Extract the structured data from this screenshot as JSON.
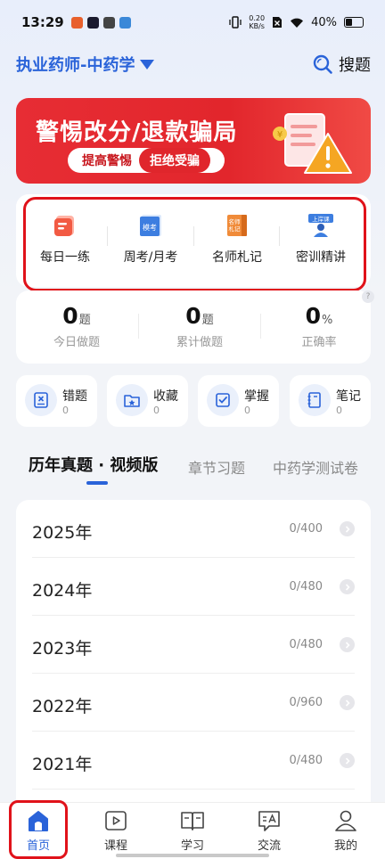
{
  "status_bar": {
    "time": "13:29",
    "net_speed_value": "0.20",
    "net_speed_unit": "KB/s",
    "battery": "40%"
  },
  "header": {
    "subject": "执业药师-中药学",
    "search_label": "搜题"
  },
  "banner": {
    "title": "警惕改分/退款骗局",
    "pill_left": "提高警惕",
    "pill_right": "拒绝受骗"
  },
  "quick_entries": [
    {
      "label": "每日一练",
      "icon_text": ""
    },
    {
      "label": "周考/月考",
      "icon_text": "模考"
    },
    {
      "label": "名师札记",
      "icon_text": "名师札记"
    },
    {
      "label": "密训精讲",
      "icon_text": "上岸课"
    }
  ],
  "stats": [
    {
      "value": "0",
      "unit": "题",
      "label": "今日做题"
    },
    {
      "value": "0",
      "unit": "题",
      "label": "累计做题"
    },
    {
      "value": "0",
      "unit": "%",
      "label": "正确率"
    }
  ],
  "stats_help": "?",
  "tools": [
    {
      "label": "错题",
      "count": "0",
      "icon": "wrong-question-icon"
    },
    {
      "label": "收藏",
      "count": "0",
      "icon": "favorite-folder-icon"
    },
    {
      "label": "掌握",
      "count": "0",
      "icon": "mastered-check-icon"
    },
    {
      "label": "笔记",
      "count": "0",
      "icon": "notebook-icon"
    }
  ],
  "tabs": [
    {
      "label": "历年真题 · 视频版",
      "active": true
    },
    {
      "label": "章节习题",
      "active": false
    },
    {
      "label": "中药学测试卷",
      "active": false
    }
  ],
  "years": [
    {
      "year": "2025年",
      "progress": "0/400"
    },
    {
      "year": "2024年",
      "progress": "0/480"
    },
    {
      "year": "2023年",
      "progress": "0/480"
    },
    {
      "year": "2022年",
      "progress": "0/960"
    },
    {
      "year": "2021年",
      "progress": "0/480"
    }
  ],
  "bottom_nav": [
    {
      "label": "首页",
      "active": true
    },
    {
      "label": "课程",
      "active": false
    },
    {
      "label": "学习",
      "active": false
    },
    {
      "label": "交流",
      "active": false
    },
    {
      "label": "我的",
      "active": false
    }
  ],
  "colors": {
    "accent": "#2a63d9",
    "banner_red": "#e2262c",
    "highlight_outline": "#e0121a"
  }
}
